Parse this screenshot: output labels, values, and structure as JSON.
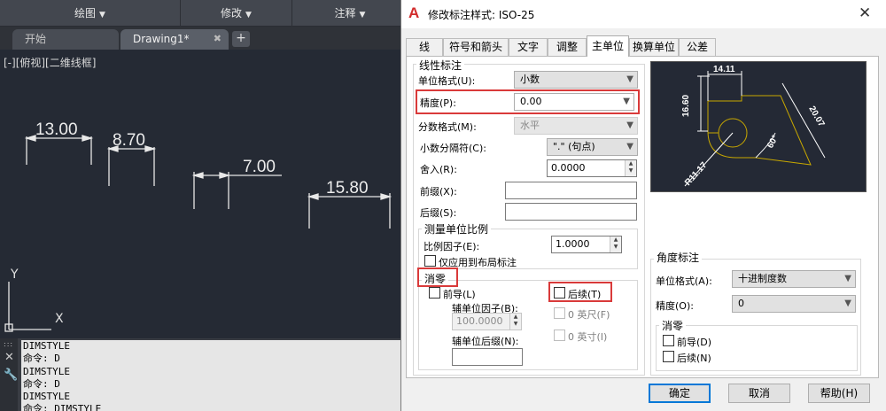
{
  "cad": {
    "ribbon": [
      "绘图",
      "修改",
      "注释"
    ],
    "tabs": [
      {
        "label": "开始"
      },
      {
        "label": "Drawing1*"
      }
    ],
    "viewport_label": "[-][俯视][二维线框]",
    "dimensions": [
      "13.00",
      "8.70",
      "7.00",
      "15.80"
    ],
    "ucs": {
      "y": "Y",
      "x": "X"
    },
    "command_lines": [
      "DIMSTYLE",
      "命令: D",
      "DIMSTYLE",
      "命令: D",
      "DIMSTYLE",
      "命令:  DIMSTYLE"
    ]
  },
  "dialog": {
    "title": "修改标注样式: ISO-25",
    "tabs": [
      "线",
      "符号和箭头",
      "文字",
      "调整",
      "主单位",
      "换算单位",
      "公差"
    ],
    "active_tab": "主单位",
    "linear": {
      "title": "线性标注",
      "unit_format_label": "单位格式(U):",
      "unit_format_value": "小数",
      "precision_label": "精度(P):",
      "precision_value": "0.00",
      "fraction_label": "分数格式(M):",
      "fraction_value": "水平",
      "decimal_sep_label": "小数分隔符(C):",
      "decimal_sep_value": "\".\" (句点)",
      "roundoff_label": "舍入(R):",
      "roundoff_value": "0.0000",
      "prefix_label": "前缀(X):",
      "suffix_label": "后缀(S):"
    },
    "scale": {
      "title": "测量单位比例",
      "factor_label": "比例因子(E):",
      "factor_value": "1.0000",
      "layout_only_label": "仅应用到布局标注"
    },
    "zero": {
      "title": "消零",
      "leading_label": "前导(L)",
      "trailing_label": "后续(T)",
      "sub_factor_label": "辅单位因子(B):",
      "sub_factor_value": "100.0000",
      "sub_suffix_label": "辅单位后缀(N):",
      "feet_label": "0 英尺(F)",
      "inches_label": "0 英寸(I)"
    },
    "preview": {
      "top": "14.11",
      "left": "16.60",
      "right": "20.07",
      "angle": "60°",
      "radius": "R11.17"
    },
    "angular": {
      "title": "角度标注",
      "unit_format_label": "单位格式(A):",
      "unit_format_value": "十进制度数",
      "precision_label": "精度(O):",
      "precision_value": "0",
      "zero_title": "消零",
      "leading_label": "前导(D)",
      "trailing_label": "后续(N)"
    },
    "buttons": {
      "ok": "确定",
      "cancel": "取消",
      "help": "帮助(H)"
    },
    "colors": {
      "highlight": "#d93a3a",
      "preview_line": "#c8a800",
      "accent": "#0078d7"
    }
  }
}
